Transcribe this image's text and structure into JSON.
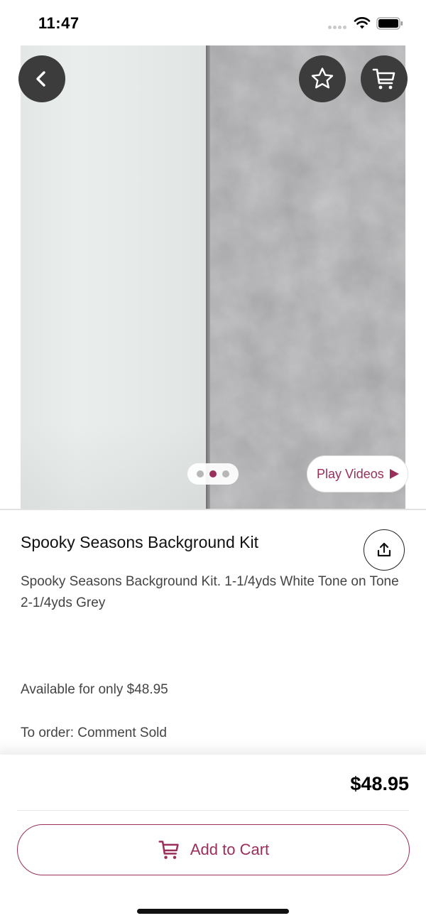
{
  "status_bar": {
    "time": "11:47",
    "icons": [
      "signal-dots",
      "wifi-icon",
      "battery-icon"
    ]
  },
  "hero": {
    "icons": {
      "back": "chevron-left-icon",
      "favorite": "star-icon",
      "cart": "cart-icon"
    },
    "pager": {
      "count": 3,
      "active_index": 1
    },
    "play_videos_label": "Play Videos"
  },
  "product": {
    "title": "Spooky Seasons Background Kit",
    "description_lines": [
      "Spooky Seasons Background Kit. 1-1/4yds White Tone on Tone",
      "2-1/4yds  Grey"
    ],
    "availability": "Available for only $48.95",
    "order_note": "To order: Comment Sold",
    "share_icon": "share-icon"
  },
  "footer": {
    "price": "$48.95",
    "add_to_cart_label": "Add to Cart"
  },
  "colors": {
    "accent": "#9a2f5c",
    "overlay_button": "#3b3c3b",
    "fabric_light": "#e6ebe9",
    "fabric_grey": "#a7a7a9"
  }
}
